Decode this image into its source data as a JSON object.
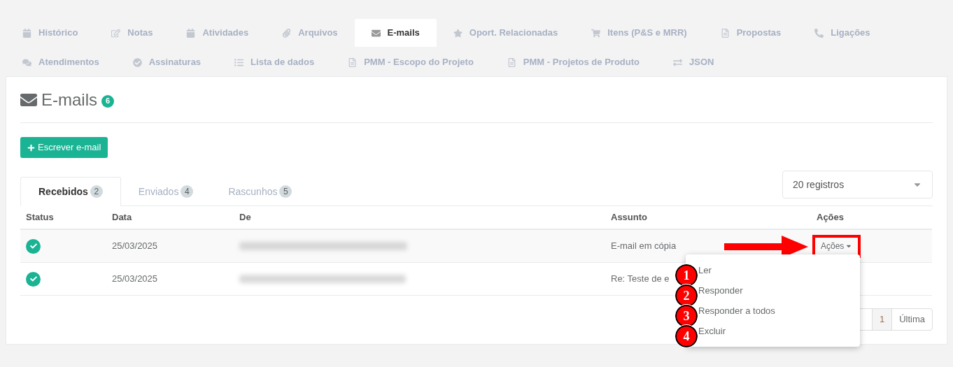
{
  "tab_rows": [
    [
      {
        "label": "Histórico",
        "kind": "calendar",
        "selected": false
      },
      {
        "label": "Notas",
        "kind": "edit",
        "selected": false
      },
      {
        "label": "Atividades",
        "kind": "calendar",
        "selected": false
      },
      {
        "label": "Arquivos",
        "kind": "paperclip",
        "selected": false
      },
      {
        "label": "E-mails",
        "kind": "envelope",
        "selected": true
      },
      {
        "label": "Oport. Relacionadas",
        "kind": "star",
        "selected": false
      },
      {
        "label": "Itens (P&S e MRR)",
        "kind": "cart",
        "selected": false
      },
      {
        "label": "Propostas",
        "kind": "file",
        "selected": false
      },
      {
        "label": "Ligações",
        "kind": "phone",
        "selected": false
      }
    ],
    [
      {
        "label": "Atendimentos",
        "kind": "comments",
        "selected": false
      },
      {
        "label": "Assinaturas",
        "kind": "check",
        "selected": false
      },
      {
        "label": "Lista de dados",
        "kind": "list",
        "selected": false
      },
      {
        "label": "PMM - Escopo do Projeto",
        "kind": "file",
        "selected": false
      },
      {
        "label": "PMM - Projetos de Produto",
        "kind": "file",
        "selected": false
      },
      {
        "label": "JSON",
        "kind": "exchange",
        "selected": false
      }
    ]
  ],
  "panel": {
    "title": "E-mails",
    "count": "6",
    "compose_button": "Escrever e-mail",
    "mail_tabs": [
      {
        "label": "Recebidos",
        "count": "2",
        "selected": true
      },
      {
        "label": "Enviados",
        "count": "4",
        "selected": false
      },
      {
        "label": "Rascunhos",
        "count": "5",
        "selected": false
      }
    ],
    "page_size": "20 registros",
    "table": {
      "columns": [
        "Status",
        "Data",
        "De",
        "Assunto",
        "Ações"
      ],
      "rows": [
        {
          "read": true,
          "date": "25/03/2025",
          "subject": "E-mail em cópia",
          "actions": "Ações"
        },
        {
          "read": true,
          "date": "25/03/2025",
          "subject": "Re: Teste de e"
        }
      ]
    },
    "pagination": [
      {
        "label": "1",
        "selected": true
      },
      {
        "label": "Última",
        "selected": false
      }
    ],
    "actions_menu": [
      {
        "label": "Ler",
        "marker": "1"
      },
      {
        "label": "Responder",
        "marker": "2"
      },
      {
        "label": "Responder a todos",
        "marker": "3"
      },
      {
        "label": "Excluir",
        "marker": "4"
      }
    ]
  }
}
